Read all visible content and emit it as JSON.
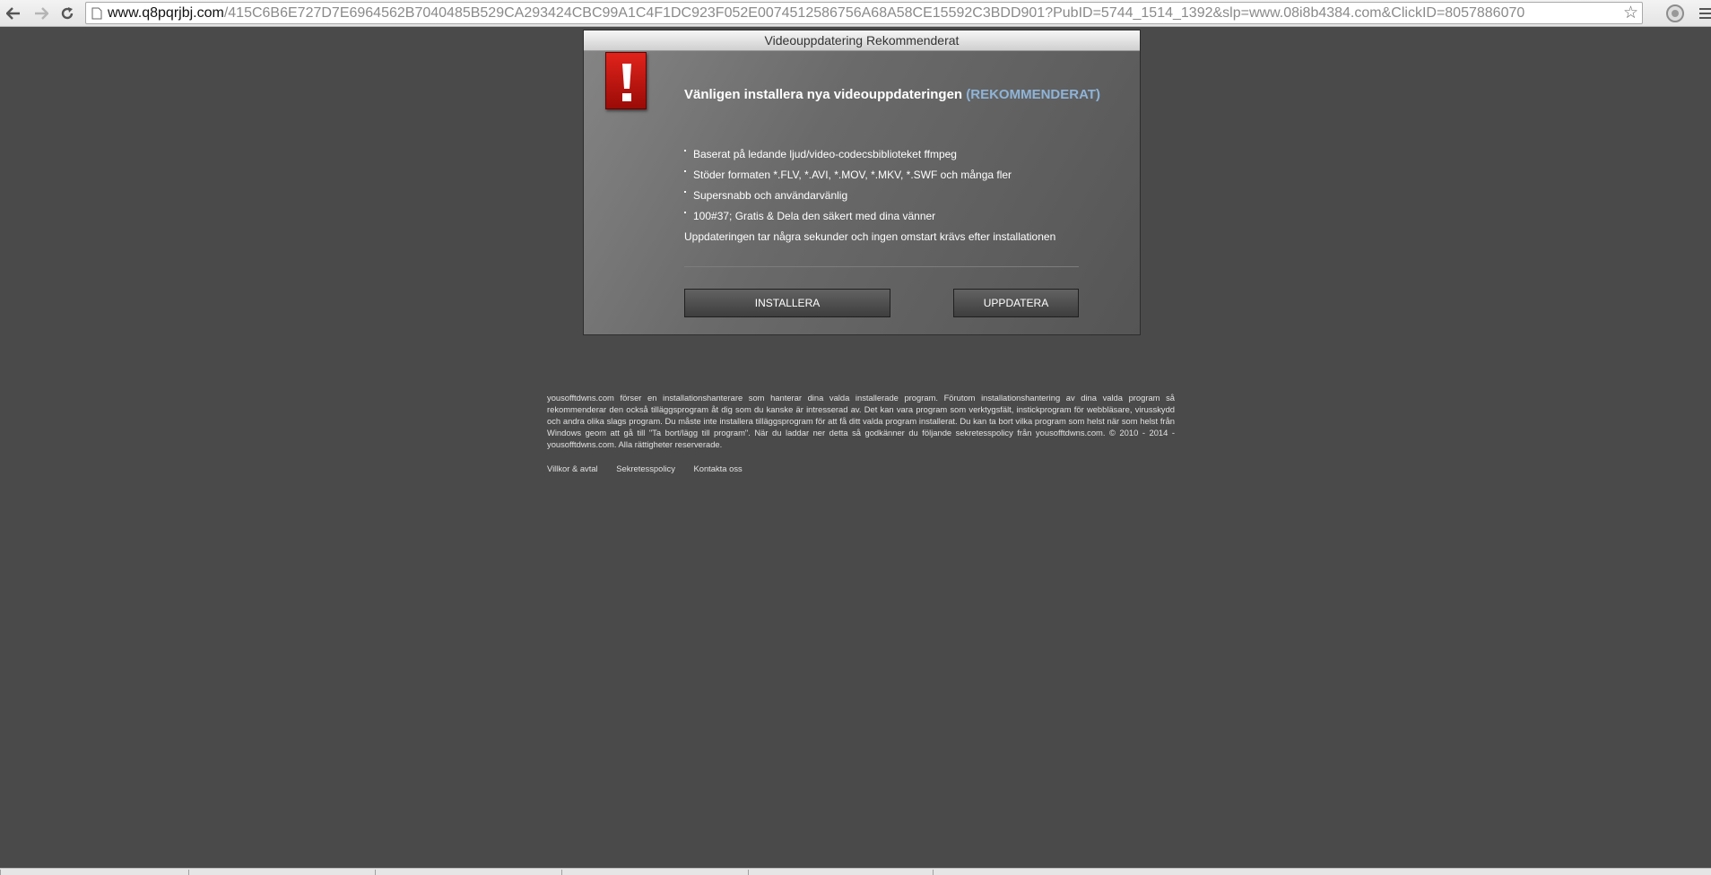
{
  "browser": {
    "url_domain": "www.q8pqrjbj.com",
    "url_path": "/415C6B6E727D7E6964562B7040485B529CA293424CBC99A1C4F1DC923F052E0074512586756A68A58CE15592C3BDD901?PubID=5744_1514_1392&slp=www.08i8b4384.com&ClickID=8057886070",
    "icons": [
      "back-arrow-icon",
      "forward-arrow-icon",
      "reload-icon",
      "page-icon",
      "star-icon",
      "extension-icon",
      "menu-icon"
    ]
  },
  "dialog": {
    "title": "Videouppdatering Rekommenderat",
    "headline": "Vänligen installera nya videouppdateringen",
    "headline_highlight": "(REKOMMENDERAT)",
    "features": [
      "Baserat på ledande ljud/video-codecsbiblioteket ffmpeg",
      "Stöder formaten *.FLV, *.AVI, *.MOV, *.MKV, *.SWF och många fler",
      "Supersnabb och användarvänlig",
      "100#37; Gratis & Dela den säkert med dina vänner"
    ],
    "note": "Uppdateringen tar några sekunder och ingen omstart krävs efter installationen",
    "install_label": "INSTALLERA",
    "update_label": "UPPDATERA",
    "accent_color": "#8fb4d8",
    "alert_color": "#d4180f"
  },
  "footer": {
    "text": "yousofftdwns.com förser en installationshanterare som hanterar dina valda installerade program. Förutom installationshantering av dina valda program så rekommenderar den också tilläggsprogram åt dig som du kanske är intresserad av. Det kan vara program som verktygsfält, instickprogram för webbläsare, virusskydd och andra olika slags program. Du måste inte installera tilläggsprogram för att få ditt valda program installerat. Du kan ta bort vilka program som helst när som helst från Windows geom att gå till \"Ta bort/lägg till program\". När du laddar ner detta så godkänner du följande sekretesspolicy från yousofftdwns.com. © 2010 - 2014 - yousofftdwns.com. Alla rättigheter reserverade.",
    "links": [
      "Villkor & avtal",
      "Sekretesspolicy",
      "Kontakta oss"
    ]
  }
}
